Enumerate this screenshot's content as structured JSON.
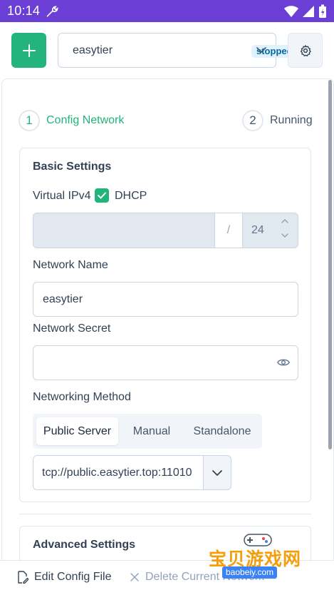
{
  "statusbar": {
    "time": "10:14"
  },
  "topbar": {
    "network_name": "easytier",
    "status_badge": "stopped"
  },
  "stepper": {
    "steps": [
      {
        "number": "1",
        "label": "Config Network"
      },
      {
        "number": "2",
        "label": "Running"
      }
    ]
  },
  "basic_settings": {
    "title": "Basic Settings",
    "virtual_ipv4_label": "Virtual IPv4",
    "dhcp_label": "DHCP",
    "ipv4_value": "",
    "slash": "/",
    "netmask": "24",
    "network_name_label": "Network Name",
    "network_name_value": "easytier",
    "network_secret_label": "Network Secret",
    "network_secret_value": "",
    "networking_method_label": "Networking Method",
    "methods": [
      "Public Server",
      "Manual",
      "Standalone"
    ],
    "public_server_value": "tcp://public.easytier.top:11010"
  },
  "advanced_settings": {
    "title": "Advanced Settings"
  },
  "bottombar": {
    "edit_label": "Edit Config File",
    "delete_label": "Delete Current Network"
  },
  "watermark": {
    "text": "宝贝游戏网",
    "url": "baobeiy.com"
  },
  "colors": {
    "accent": "#22b47a",
    "statusbar": "#6b3fd6",
    "badge_bg": "#e0f2fe",
    "badge_text": "#0369a1"
  }
}
